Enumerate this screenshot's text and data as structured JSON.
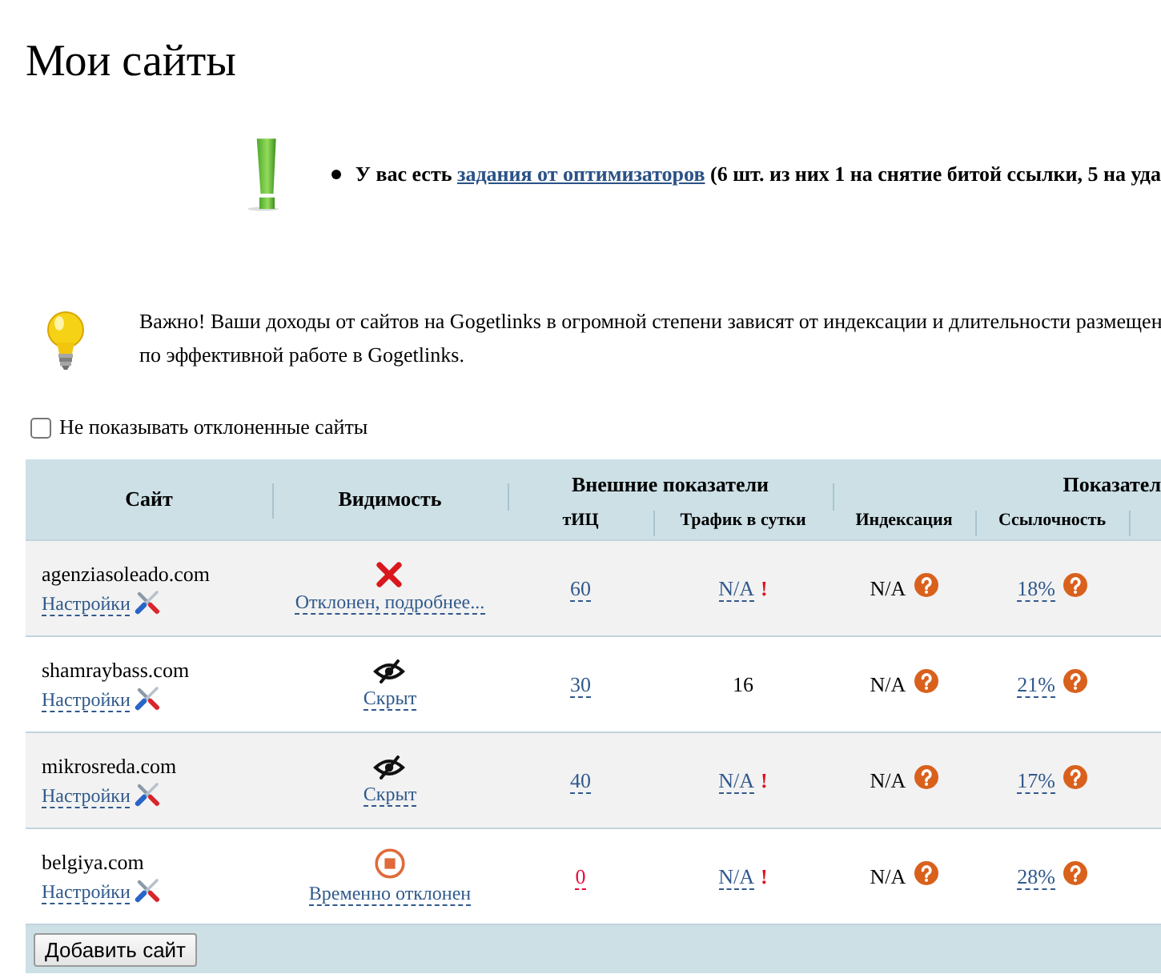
{
  "title": "Мои сайты",
  "notice": {
    "text_before": "У вас есть",
    "link": "задания от оптимизаторов",
    "text_after": "(6 шт. из них 1 на снятие битой ссылки, 5 на уда"
  },
  "info": {
    "lines": [
      "Важно! Ваши доходы от сайтов на Gogetlinks в огромной степени зависят от индексации и длительности размещен",
      "по эффективной работе в Gogetlinks."
    ]
  },
  "filter": {
    "label": "Не показывать отклоненные сайты",
    "checked": false
  },
  "table": {
    "header": {
      "site": "Сайт",
      "visibility": "Видимость",
      "groups": [
        {
          "label": "Внешние показатели",
          "columns": [
            "тИЦ",
            "Трафик в сутки"
          ]
        },
        {
          "label": "Показател",
          "columns": [
            "Индексация",
            "Ссылочность"
          ]
        }
      ]
    },
    "rows": [
      {
        "site": "agenziasoleado.com",
        "settings": "Настройки",
        "visibility": {
          "kind": "rejected",
          "label": "Отклонен, подробнее..."
        },
        "tic": {
          "value": "60",
          "alert": false
        },
        "traffic": {
          "kind": "link",
          "value": "N/A",
          "flag": "!"
        },
        "indexation": "N/A",
        "link_share": "18%"
      },
      {
        "site": "shamraybass.com",
        "settings": "Настройки",
        "visibility": {
          "kind": "hidden",
          "label": "Скрыт"
        },
        "tic": {
          "value": "30",
          "alert": false
        },
        "traffic": {
          "kind": "plain",
          "value": "16"
        },
        "indexation": "N/A",
        "link_share": "21%"
      },
      {
        "site": "mikrosreda.com",
        "settings": "Настройки",
        "visibility": {
          "kind": "hidden",
          "label": "Скрыт"
        },
        "tic": {
          "value": "40",
          "alert": false
        },
        "traffic": {
          "kind": "link",
          "value": "N/A",
          "flag": "!"
        },
        "indexation": "N/A",
        "link_share": "17%"
      },
      {
        "site": "belgiya.com",
        "settings": "Настройки",
        "visibility": {
          "kind": "suspended",
          "label": "Временно отклонен"
        },
        "tic": {
          "value": "0",
          "alert": true
        },
        "traffic": {
          "kind": "link",
          "value": "N/A",
          "flag": "!"
        },
        "indexation": "N/A",
        "link_share": "28%"
      }
    ]
  },
  "add_button": "Добавить сайт"
}
